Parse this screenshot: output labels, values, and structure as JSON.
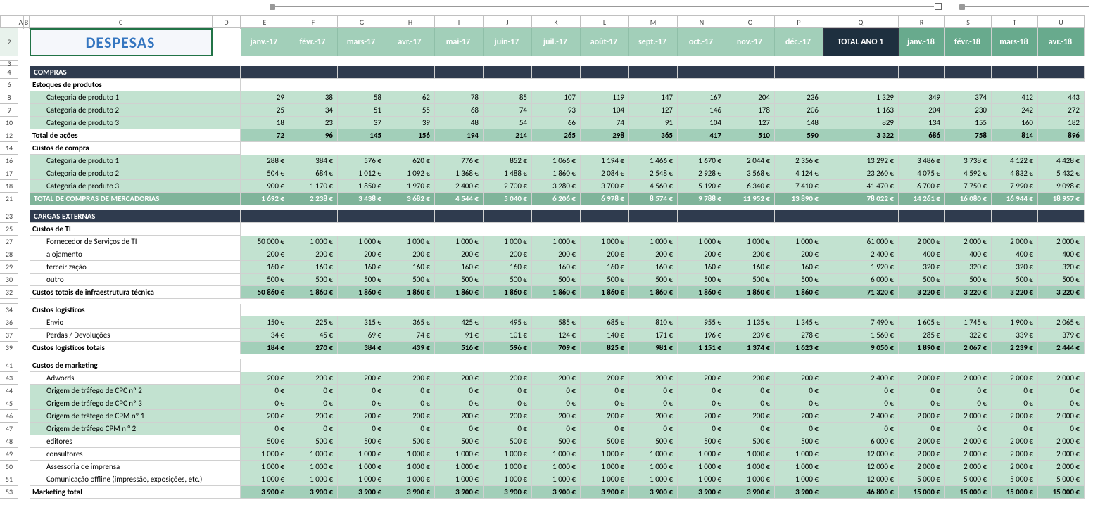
{
  "title": "DESPESAS",
  "cols": [
    "A",
    "B",
    "C",
    "D",
    "E",
    "F",
    "G",
    "H",
    "I",
    "J",
    "K",
    "L",
    "M",
    "N",
    "O",
    "P",
    "Q",
    "R",
    "S",
    "T",
    "U"
  ],
  "row_nums": [
    "2",
    "",
    "3",
    "4",
    "6",
    "8",
    "9",
    "10",
    "12",
    "14",
    "16",
    "17",
    "18",
    "21",
    "",
    "23",
    "25",
    "27",
    "28",
    "29",
    "30",
    "32",
    "",
    "34",
    "36",
    "37",
    "39",
    "",
    "41",
    "43",
    "44",
    "45",
    "46",
    "47",
    "48",
    "49",
    "50",
    "51",
    "53"
  ],
  "months_y1": [
    "janv.-17",
    "févr.-17",
    "mars-17",
    "avr.-17",
    "mai-17",
    "juin-17",
    "juil.-17",
    "août-17",
    "sept.-17",
    "oct.-17",
    "nov.-17",
    "déc.-17"
  ],
  "total_y1": "TOTAL ANO 1",
  "months_y2": [
    "janv.-18",
    "févr.-18",
    "mars-18",
    "avr.-18"
  ],
  "sections": {
    "compras": "COMPRAS",
    "cargas": "CARGAS EXTERNAS"
  },
  "subheads": {
    "estoques": "Estoques de produtos",
    "total_acoes": "Total de ações",
    "custos_compra": "Custos de compra",
    "total_compras_merc": "TOTAL DE COMPRAS DE MERCADORIAS",
    "custos_ti": "Custos de TI",
    "custos_ti_total": "Custos totais de infraestrutura técnica",
    "custos_log": "Custos logísticos",
    "custos_log_total": "Custos logísticos totais",
    "custos_mkt": "Custos de marketing",
    "mkt_total": "Marketing total"
  },
  "labels": {
    "cat1": "Categoria de produto 1",
    "cat2": "Categoria de produto 2",
    "cat3": "Categoria de produto 3",
    "fornecedor_ti": "Fornecedor de Serviços de TI",
    "alojamento": "alojamento",
    "terceirizacao": "terceirização",
    "outro": "outro",
    "envio": "Envio",
    "perdas": "Perdas / Devoluções",
    "adwords": "Adwords",
    "cpc2": "Origem de tráfego de CPC nº 2",
    "cpc3": "Origem de tráfego de CPC nº 3",
    "cpm1": "Origem de tráfego de CPM nº 1",
    "cpm2": "Origem de tráfego CPM n ° 2",
    "editores": "editores",
    "consultores": "consultores",
    "assessoria": "Assessoria de imprensa",
    "offline": "Comunicação offline (impressão, exposições, etc.)"
  },
  "rows": {
    "est1": {
      "m": [
        "29",
        "38",
        "58",
        "62",
        "78",
        "85",
        "107",
        "119",
        "147",
        "167",
        "204",
        "236"
      ],
      "t": "1 329",
      "y2": [
        "349",
        "374",
        "412",
        "443"
      ]
    },
    "est2": {
      "m": [
        "25",
        "34",
        "51",
        "55",
        "68",
        "74",
        "93",
        "104",
        "127",
        "146",
        "178",
        "206"
      ],
      "t": "1 163",
      "y2": [
        "204",
        "230",
        "242",
        "272"
      ]
    },
    "est3": {
      "m": [
        "18",
        "23",
        "37",
        "39",
        "48",
        "54",
        "66",
        "74",
        "91",
        "104",
        "127",
        "148"
      ],
      "t": "829",
      "y2": [
        "134",
        "155",
        "160",
        "182"
      ]
    },
    "acoes": {
      "m": [
        "72",
        "96",
        "145",
        "156",
        "194",
        "214",
        "265",
        "298",
        "365",
        "417",
        "510",
        "590"
      ],
      "t": "3 322",
      "y2": [
        "686",
        "758",
        "814",
        "896"
      ]
    },
    "cc1": {
      "m": [
        "288 €",
        "384 €",
        "576 €",
        "620 €",
        "776 €",
        "852 €",
        "1 066 €",
        "1 194 €",
        "1 466 €",
        "1 670 €",
        "2 044 €",
        "2 356 €"
      ],
      "t": "13 292 €",
      "y2": [
        "3 486 €",
        "3 738 €",
        "4 122 €",
        "4 428 €"
      ]
    },
    "cc2": {
      "m": [
        "504 €",
        "684 €",
        "1 012 €",
        "1 092 €",
        "1 368 €",
        "1 488 €",
        "1 860 €",
        "2 084 €",
        "2 548 €",
        "2 928 €",
        "3 568 €",
        "4 124 €"
      ],
      "t": "23 260 €",
      "y2": [
        "4 075 €",
        "4 592 €",
        "4 832 €",
        "5 432 €"
      ]
    },
    "cc3": {
      "m": [
        "900 €",
        "1 170 €",
        "1 850 €",
        "1 970 €",
        "2 400 €",
        "2 700 €",
        "3 280 €",
        "3 700 €",
        "4 560 €",
        "5 190 €",
        "6 340 €",
        "7 410 €"
      ],
      "t": "41 470 €",
      "y2": [
        "6 700 €",
        "7 750 €",
        "7 990 €",
        "9 098 €"
      ]
    },
    "tcm": {
      "m": [
        "1 692 €",
        "2 238 €",
        "3 438 €",
        "3 682 €",
        "4 544 €",
        "5 040 €",
        "6 206 €",
        "6 978 €",
        "8 574 €",
        "9 788 €",
        "11 952 €",
        "13 890 €"
      ],
      "t": "78 022 €",
      "y2": [
        "14 261 €",
        "16 080 €",
        "16 944 €",
        "18 957 €"
      ]
    },
    "ti1": {
      "m": [
        "50 000 €",
        "1 000 €",
        "1 000 €",
        "1 000 €",
        "1 000 €",
        "1 000 €",
        "1 000 €",
        "1 000 €",
        "1 000 €",
        "1 000 €",
        "1 000 €",
        "1 000 €"
      ],
      "t": "61 000 €",
      "y2": [
        "2 000 €",
        "2 000 €",
        "2 000 €",
        "2 000 €"
      ]
    },
    "ti2": {
      "m": [
        "200 €",
        "200 €",
        "200 €",
        "200 €",
        "200 €",
        "200 €",
        "200 €",
        "200 €",
        "200 €",
        "200 €",
        "200 €",
        "200 €"
      ],
      "t": "2 400 €",
      "y2": [
        "400 €",
        "400 €",
        "400 €",
        "400 €"
      ]
    },
    "ti3": {
      "m": [
        "160 €",
        "160 €",
        "160 €",
        "160 €",
        "160 €",
        "160 €",
        "160 €",
        "160 €",
        "160 €",
        "160 €",
        "160 €",
        "160 €"
      ],
      "t": "1 920 €",
      "y2": [
        "320 €",
        "320 €",
        "320 €",
        "320 €"
      ]
    },
    "ti4": {
      "m": [
        "500 €",
        "500 €",
        "500 €",
        "500 €",
        "500 €",
        "500 €",
        "500 €",
        "500 €",
        "500 €",
        "500 €",
        "500 €",
        "500 €"
      ],
      "t": "6 000 €",
      "y2": [
        "500 €",
        "500 €",
        "500 €",
        "500 €"
      ]
    },
    "tit": {
      "m": [
        "50 860 €",
        "1 860 €",
        "1 860 €",
        "1 860 €",
        "1 860 €",
        "1 860 €",
        "1 860 €",
        "1 860 €",
        "1 860 €",
        "1 860 €",
        "1 860 €",
        "1 860 €"
      ],
      "t": "71 320 €",
      "y2": [
        "3 220 €",
        "3 220 €",
        "3 220 €",
        "3 220 €"
      ]
    },
    "log1": {
      "m": [
        "150 €",
        "225 €",
        "315 €",
        "365 €",
        "425 €",
        "495 €",
        "585 €",
        "685 €",
        "810 €",
        "955 €",
        "1 135 €",
        "1 345 €"
      ],
      "t": "7 490 €",
      "y2": [
        "1 605 €",
        "1 745 €",
        "1 900 €",
        "2 065 €"
      ]
    },
    "log2": {
      "m": [
        "34 €",
        "45 €",
        "69 €",
        "74 €",
        "91 €",
        "101 €",
        "124 €",
        "140 €",
        "171 €",
        "196 €",
        "239 €",
        "278 €"
      ],
      "t": "1 560 €",
      "y2": [
        "285 €",
        "322 €",
        "339 €",
        "379 €"
      ]
    },
    "logt": {
      "m": [
        "184 €",
        "270 €",
        "384 €",
        "439 €",
        "516 €",
        "596 €",
        "709 €",
        "825 €",
        "981 €",
        "1 151 €",
        "1 374 €",
        "1 623 €"
      ],
      "t": "9 050 €",
      "y2": [
        "1 890 €",
        "2 067 €",
        "2 239 €",
        "2 444 €"
      ]
    },
    "mk1": {
      "m": [
        "200 €",
        "200 €",
        "200 €",
        "200 €",
        "200 €",
        "200 €",
        "200 €",
        "200 €",
        "200 €",
        "200 €",
        "200 €",
        "200 €"
      ],
      "t": "2 400 €",
      "y2": [
        "2 000 €",
        "2 000 €",
        "2 000 €",
        "2 000 €"
      ]
    },
    "mk2": {
      "m": [
        "0 €",
        "0 €",
        "0 €",
        "0 €",
        "0 €",
        "0 €",
        "0 €",
        "0 €",
        "0 €",
        "0 €",
        "0 €",
        "0 €"
      ],
      "t": "0 €",
      "y2": [
        "0 €",
        "0 €",
        "0 €",
        "0 €"
      ]
    },
    "mk3": {
      "m": [
        "0 €",
        "0 €",
        "0 €",
        "0 €",
        "0 €",
        "0 €",
        "0 €",
        "0 €",
        "0 €",
        "0 €",
        "0 €",
        "0 €"
      ],
      "t": "0 €",
      "y2": [
        "0 €",
        "0 €",
        "0 €",
        "0 €"
      ]
    },
    "mk4": {
      "m": [
        "200 €",
        "200 €",
        "200 €",
        "200 €",
        "200 €",
        "200 €",
        "200 €",
        "200 €",
        "200 €",
        "200 €",
        "200 €",
        "200 €"
      ],
      "t": "2 400 €",
      "y2": [
        "2 000 €",
        "2 000 €",
        "2 000 €",
        "2 000 €"
      ]
    },
    "mk5": {
      "m": [
        "0 €",
        "0 €",
        "0 €",
        "0 €",
        "0 €",
        "0 €",
        "0 €",
        "0 €",
        "0 €",
        "0 €",
        "0 €",
        "0 €"
      ],
      "t": "0 €",
      "y2": [
        "0 €",
        "0 €",
        "0 €",
        "0 €"
      ]
    },
    "mk6": {
      "m": [
        "500 €",
        "500 €",
        "500 €",
        "500 €",
        "500 €",
        "500 €",
        "500 €",
        "500 €",
        "500 €",
        "500 €",
        "500 €",
        "500 €"
      ],
      "t": "6 000 €",
      "y2": [
        "2 000 €",
        "2 000 €",
        "2 000 €",
        "2 000 €"
      ]
    },
    "mk7": {
      "m": [
        "1 000 €",
        "1 000 €",
        "1 000 €",
        "1 000 €",
        "1 000 €",
        "1 000 €",
        "1 000 €",
        "1 000 €",
        "1 000 €",
        "1 000 €",
        "1 000 €",
        "1 000 €"
      ],
      "t": "12 000 €",
      "y2": [
        "2 000 €",
        "2 000 €",
        "2 000 €",
        "2 000 €"
      ]
    },
    "mk8": {
      "m": [
        "1 000 €",
        "1 000 €",
        "1 000 €",
        "1 000 €",
        "1 000 €",
        "1 000 €",
        "1 000 €",
        "1 000 €",
        "1 000 €",
        "1 000 €",
        "1 000 €",
        "1 000 €"
      ],
      "t": "12 000 €",
      "y2": [
        "2 000 €",
        "2 000 €",
        "2 000 €",
        "2 000 €"
      ]
    },
    "mk9": {
      "m": [
        "1 000 €",
        "1 000 €",
        "1 000 €",
        "1 000 €",
        "1 000 €",
        "1 000 €",
        "1 000 €",
        "1 000 €",
        "1 000 €",
        "1 000 €",
        "1 000 €",
        "1 000 €"
      ],
      "t": "12 000 €",
      "y2": [
        "5 000 €",
        "5 000 €",
        "5 000 €",
        "5 000 €"
      ]
    },
    "mkt": {
      "m": [
        "3 900 €",
        "3 900 €",
        "3 900 €",
        "3 900 €",
        "3 900 €",
        "3 900 €",
        "3 900 €",
        "3 900 €",
        "3 900 €",
        "3 900 €",
        "3 900 €",
        "3 900 €"
      ],
      "t": "46 800 €",
      "y2": [
        "15 000 €",
        "15 000 €",
        "15 000 €",
        "15 000 €"
      ]
    }
  }
}
